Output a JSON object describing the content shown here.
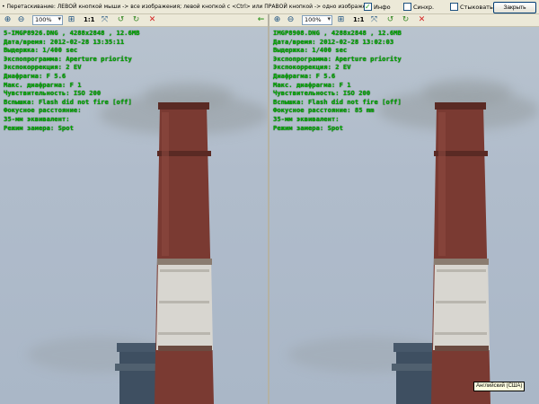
{
  "top_bar": {
    "hint": "• Перетаскивание: ЛЕВОЙ кнопкой мыши -> все изображения; левой кнопкой с <Ctrl> или ПРАВОЙ кнопкой -> одно изображение. Масштабирование: колесико мыши",
    "checkbox_info_label": "Инфо",
    "checkbox_info_checked": true,
    "checkbox_sync_label": "Синхр.",
    "checkbox_sync_checked": false,
    "checkbox_compare_label": "Стыковать",
    "checkbox_compare_checked": false,
    "close_button": "Закрыть"
  },
  "toolbar": {
    "zoom_in_icon": "zoom-in-icon",
    "zoom_out_icon": "zoom-out-icon",
    "zoom_value": "100%",
    "one_to_one": "1:1",
    "colors": {
      "accent": "#1c5180",
      "info_text": "#00a800",
      "delete": "#d42020"
    }
  },
  "left_image": {
    "filename": "5-IMGP8926.DNG , 4288x2848 , 12.6MB",
    "date": "Дата/время: 2012-02-28 13:35:11",
    "shutter": "Выдержка: 1/400 sec",
    "program": "Экспопрограмма: Aperture priority",
    "exposure_comp": "Экспокоррекция: 2 EV",
    "aperture": "Диафрагма: F 5.6",
    "max_aperture": "Макс. диафрагма: F 1",
    "iso": "Чувствительность: ISO 200",
    "flash": "Вспышка: Flash did not fire [off]",
    "focal": "Фокусное расстояние:",
    "focal35": "35-мм эквивалент:",
    "metering": "Режим замера: Spot"
  },
  "right_image": {
    "filename": "IMGP8908.DNG , 4288x2848 , 12.6MB",
    "date": "Дата/время: 2012-02-28 13:02:03",
    "shutter": "Выдержка: 1/400 sec",
    "program": "Экспопрограмма: Aperture priority",
    "exposure_comp": "Экспокоррекция: 2 EV",
    "aperture": "Диафрагма: F 5.6",
    "max_aperture": "Макс. диафрагма: F 1",
    "iso": "Чувствительность: ISO 200",
    "flash": "Вспышка: Flash did not fire [off]",
    "focal": "Фокусное расстояние: 85 mm",
    "focal35": "35-мм эквивалент:",
    "metering": "Режим замера: Spot"
  },
  "tooltip": "Английский (США)"
}
